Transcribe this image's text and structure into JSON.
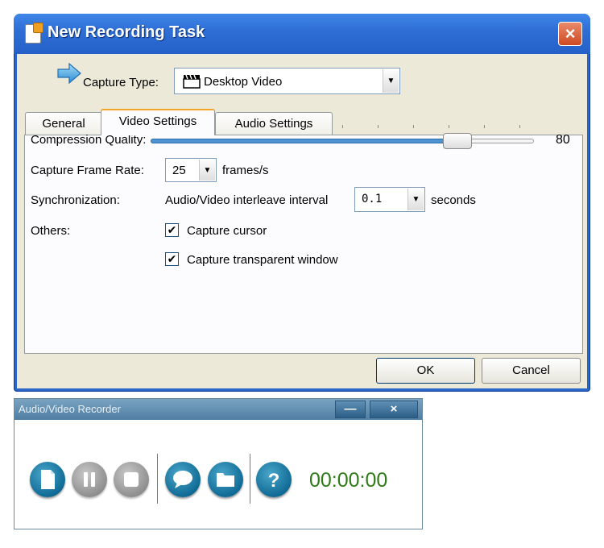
{
  "dialog": {
    "title": "New Recording Task",
    "capture_type_label": "Capture Type:",
    "capture_type_value": "Desktop Video",
    "tabs": [
      {
        "label": "General"
      },
      {
        "label": "Video Settings"
      },
      {
        "label": "Audio Settings"
      }
    ],
    "compression_label": "Compression Quality:",
    "compression_value": "80",
    "frame_rate_label": "Capture Frame Rate:",
    "frame_rate_value": "25",
    "frame_rate_unit": "frames/s",
    "sync_label": "Synchronization:",
    "sync_desc": "Audio/Video interleave interval",
    "sync_value": "0.1",
    "sync_unit": "seconds",
    "others_label": "Others:",
    "capture_cursor_label": "Capture cursor",
    "capture_transparent_label": "Capture transparent window",
    "ok_label": "OK",
    "cancel_label": "Cancel"
  },
  "recorder": {
    "title": "Audio/Video Recorder",
    "minimize_glyph": "—",
    "close_glyph": "×",
    "timer": "00:00:00",
    "help_glyph": "?"
  },
  "colors": {
    "titlebar": "#2f6fd6",
    "recorder_button": "#106b96",
    "timer": "#2e7a16"
  }
}
